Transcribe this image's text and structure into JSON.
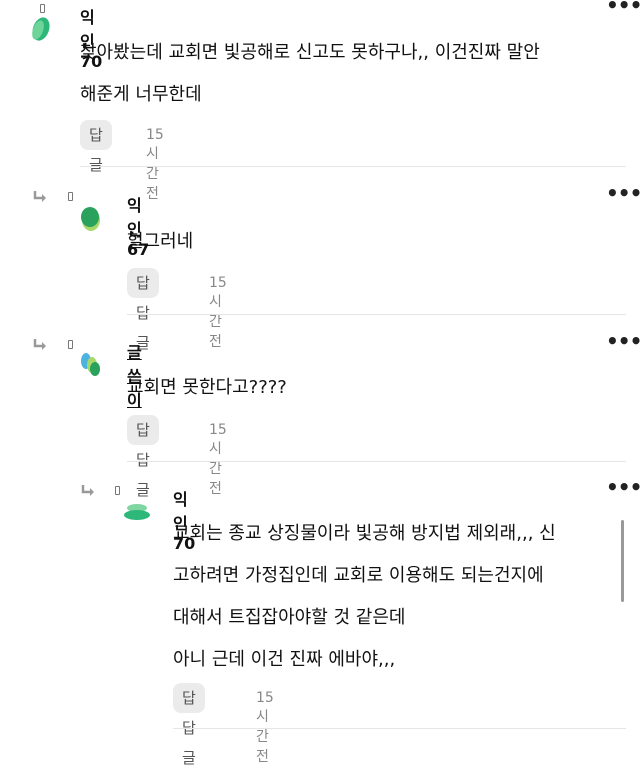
{
  "comments": [
    {
      "nick": "익인70",
      "lines": [
        "찾아봤는데 교회면 빛공해로 신고도 못하구나,, 이건진짜 말안",
        "해준게 너무한데"
      ],
      "reply_label": "답글",
      "time": "15시간전",
      "more": "•••",
      "avatar_colors": [
        "#2db87a",
        "#6fd49a"
      ]
    },
    {
      "nick": "익인67",
      "lines": [
        "헐그러네"
      ],
      "reply_label": "답답글",
      "time": "15시간전",
      "more": "•••",
      "avatar_colors": [
        "#2aa15c",
        "#a8d86a"
      ]
    },
    {
      "nick": "글쓴이",
      "lines": [
        "교회면 못한다고????"
      ],
      "reply_label": "답답글",
      "time": "15시간전",
      "more": "•••",
      "avatar_colors": [
        "#4cb3e0",
        "#a8d86a",
        "#2aa15c"
      ]
    },
    {
      "nick": "익인70",
      "lines": [
        "교회는 종교 상징물이라 빛공해 방지법 제외래,,, 신",
        "고하려면 가정집인데 교회로 이용해도 되는건지에",
        "대해서 트집잡아야할 것 같은데",
        "아니 근데 이건 진짜 에바야,,,"
      ],
      "reply_label": "답답글",
      "time": "15시간전",
      "more": "•••",
      "avatar_colors": [
        "#2db87a",
        "#7fd6a2"
      ]
    }
  ],
  "colors": {
    "accent_green": "#2db87a",
    "button_bg": "#ebebeb",
    "divider": "#e6e6e6",
    "muted_text": "#888888"
  }
}
